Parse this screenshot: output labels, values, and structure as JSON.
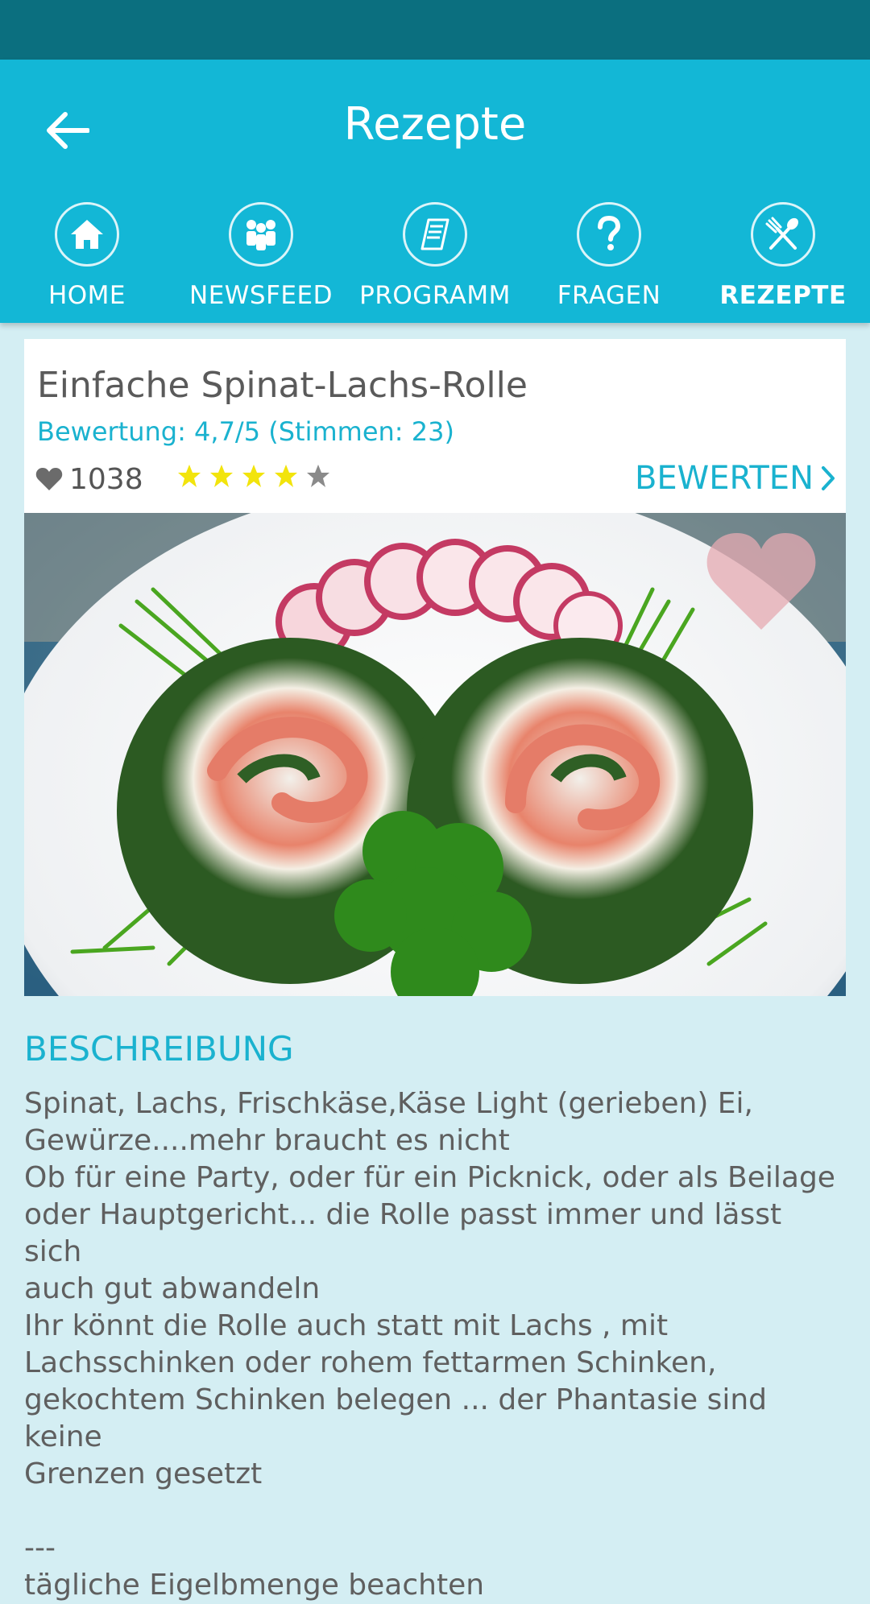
{
  "header": {
    "title": "Rezepte"
  },
  "nav": {
    "tabs": [
      {
        "label": "HOME",
        "icon": "home-icon",
        "active": false
      },
      {
        "label": "NEWSFEED",
        "icon": "people-icon",
        "active": false
      },
      {
        "label": "PROGRAMM",
        "icon": "document-icon",
        "active": false
      },
      {
        "label": "FRAGEN",
        "icon": "question-icon",
        "active": false
      },
      {
        "label": "REZEPTE",
        "icon": "cutlery-icon",
        "active": true
      }
    ]
  },
  "recipe": {
    "title": "Einfache Spinat-Lachs-Rolle",
    "rating_text": "Bewertung: 4,7/5 (Stimmen: 23)",
    "likes": "1038",
    "stars_filled": 4,
    "stars_total": 5,
    "rate_label": "BEWERTEN",
    "image": "salmon-spinach-roll-photo"
  },
  "description": {
    "heading": "BESCHREIBUNG",
    "text": "Spinat, Lachs, Frischkäse,Käse Light (gerieben) Ei,\nGewürze....mehr braucht es nicht\nOb für eine Party, oder für ein Picknick, oder als Beilage\noder Hauptgericht... die Rolle passt immer und lässt sich\nauch gut abwandeln\nIhr könnt die Rolle auch statt mit Lachs , mit\nLachsschinken oder rohem fettarmen Schinken,\ngekochtem Schinken belegen ... der Phantasie sind keine\nGrenzen gesetzt\n\n---\ntägliche Eigelbmenge beachten"
  },
  "colors": {
    "status_bar": "#0b6f7f",
    "app_bar": "#13b7d6",
    "background": "#d4eef3",
    "accent": "#1ab2cf",
    "star": "#f2e40c"
  }
}
